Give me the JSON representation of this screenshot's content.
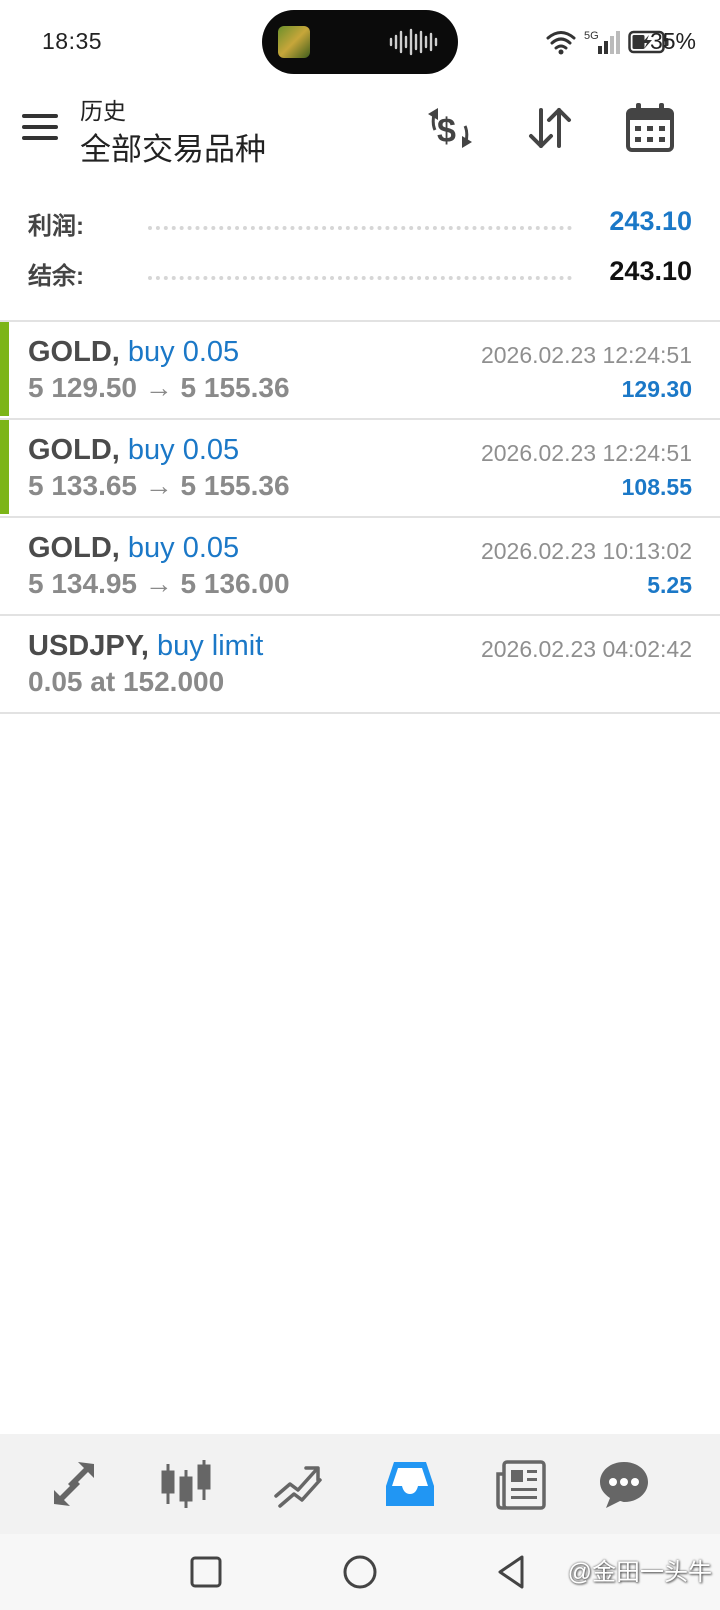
{
  "status_bar": {
    "time": "18:35",
    "battery_percent": "35%",
    "network": "5G",
    "icons": [
      "wifi-icon",
      "signal-icon",
      "battery-charging-icon"
    ]
  },
  "header": {
    "subtitle": "历史",
    "title": "全部交易品种",
    "actions": [
      "currency-exchange-icon",
      "sort-icon",
      "calendar-icon"
    ]
  },
  "summary": {
    "profit_label": "利润:",
    "profit_value": "243.10",
    "balance_label": "结余:",
    "balance_value": "243.10",
    "colors": {
      "profit": "#1b78c7",
      "balance": "#111111"
    }
  },
  "trades": [
    {
      "symbol": "GOLD,",
      "type": "buy 0.05",
      "prices": "5 129.50 → 5 155.36",
      "time": "2026.02.23 12:24:51",
      "profit": "129.30",
      "accent": true
    },
    {
      "symbol": "GOLD,",
      "type": "buy 0.05",
      "prices": "5 133.65 → 5 155.36",
      "time": "2026.02.23 12:24:51",
      "profit": "108.55",
      "accent": true
    },
    {
      "symbol": "GOLD,",
      "type": "buy 0.05",
      "prices": "5 134.95 → 5 136.00",
      "time": "2026.02.23 10:13:02",
      "profit": "5.25",
      "accent": false
    },
    {
      "symbol": "USDJPY,",
      "type": "buy limit",
      "prices": "0.05 at 152.000",
      "time": "2026.02.23 04:02:42",
      "profit": "",
      "accent": false
    }
  ],
  "bottom_nav": {
    "items": [
      "quotes-icon",
      "chart-icon",
      "trade-icon",
      "history-icon",
      "news-icon",
      "chat-icon"
    ],
    "active": "history-icon",
    "active_color": "#2196f3"
  },
  "system_nav": {
    "items": [
      "recents-icon",
      "home-icon",
      "back-icon"
    ],
    "watermark": "@金田一头牛"
  }
}
